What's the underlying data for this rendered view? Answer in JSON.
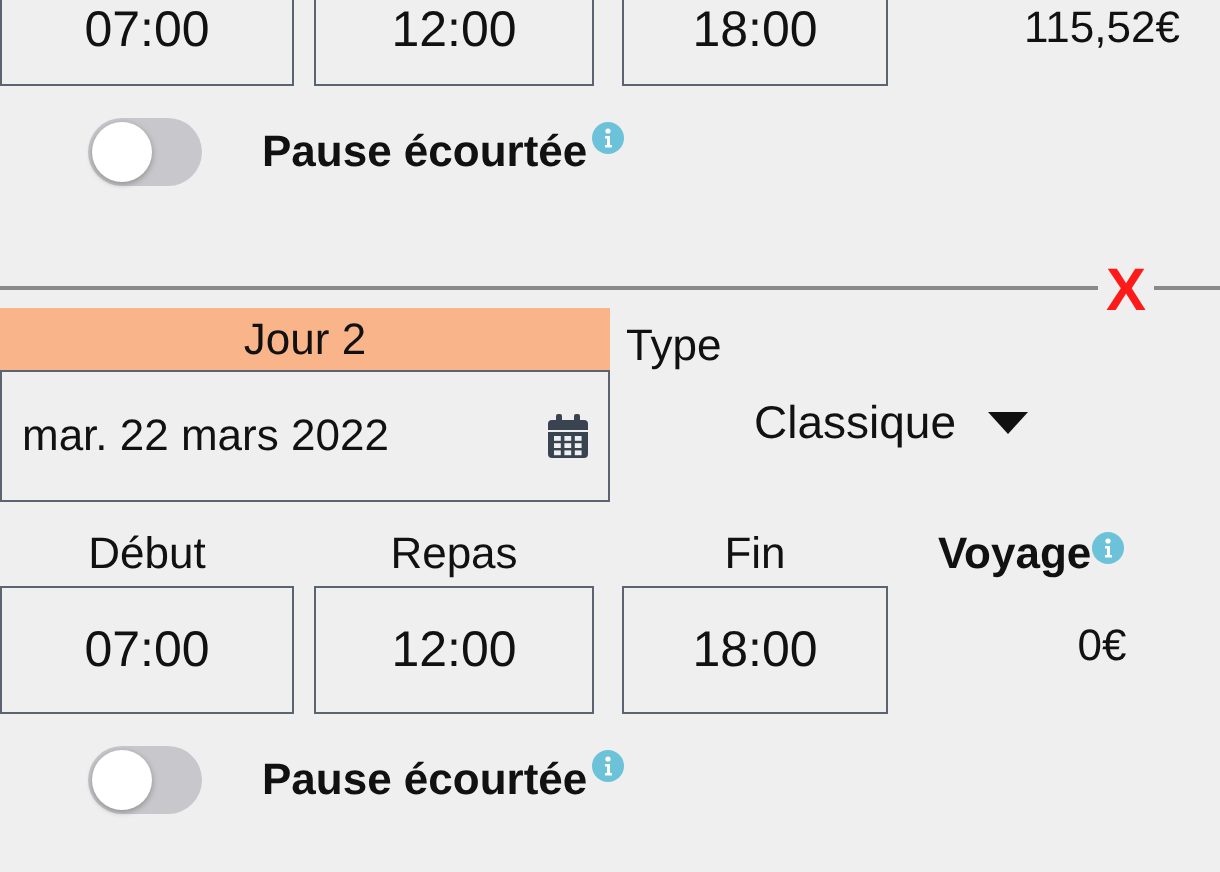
{
  "days": [
    {
      "times": [
        {
          "value": "07:00"
        },
        {
          "value": "12:00"
        },
        {
          "value": "18:00"
        }
      ],
      "voyage": "115,52€",
      "pause": {
        "label": "Pause écourtée",
        "on": false
      }
    },
    {
      "title": "Jour 2",
      "delete": "X",
      "date": "mar. 22 mars 2022",
      "type_label": "Type",
      "type_value": "Classique",
      "columns": [
        "Début",
        "Repas",
        "Fin",
        "Voyage"
      ],
      "times": [
        {
          "value": "07:00"
        },
        {
          "value": "12:00"
        },
        {
          "value": "18:00"
        }
      ],
      "voyage": "0€",
      "pause": {
        "label": "Pause écourtée",
        "on": false
      }
    }
  ]
}
